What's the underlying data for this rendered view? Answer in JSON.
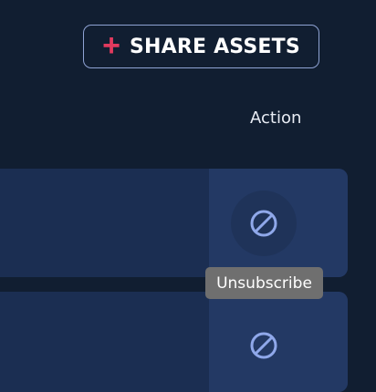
{
  "toolbar": {
    "share_button": {
      "icon": "plus-icon",
      "label": "SHARE ASSETS"
    }
  },
  "table": {
    "column_header": "Action",
    "rows": [
      {
        "action_icon": "block-icon"
      },
      {
        "action_icon": "block-icon"
      }
    ]
  },
  "tooltip": {
    "text": "Unsubscribe"
  },
  "colors": {
    "background": "#111e31",
    "row": "#1b2e52",
    "action_cell": "#233964",
    "accent_plus": "#e23a5e",
    "icon": "#8fa8ea",
    "tooltip_bg": "#6f6f6f"
  }
}
